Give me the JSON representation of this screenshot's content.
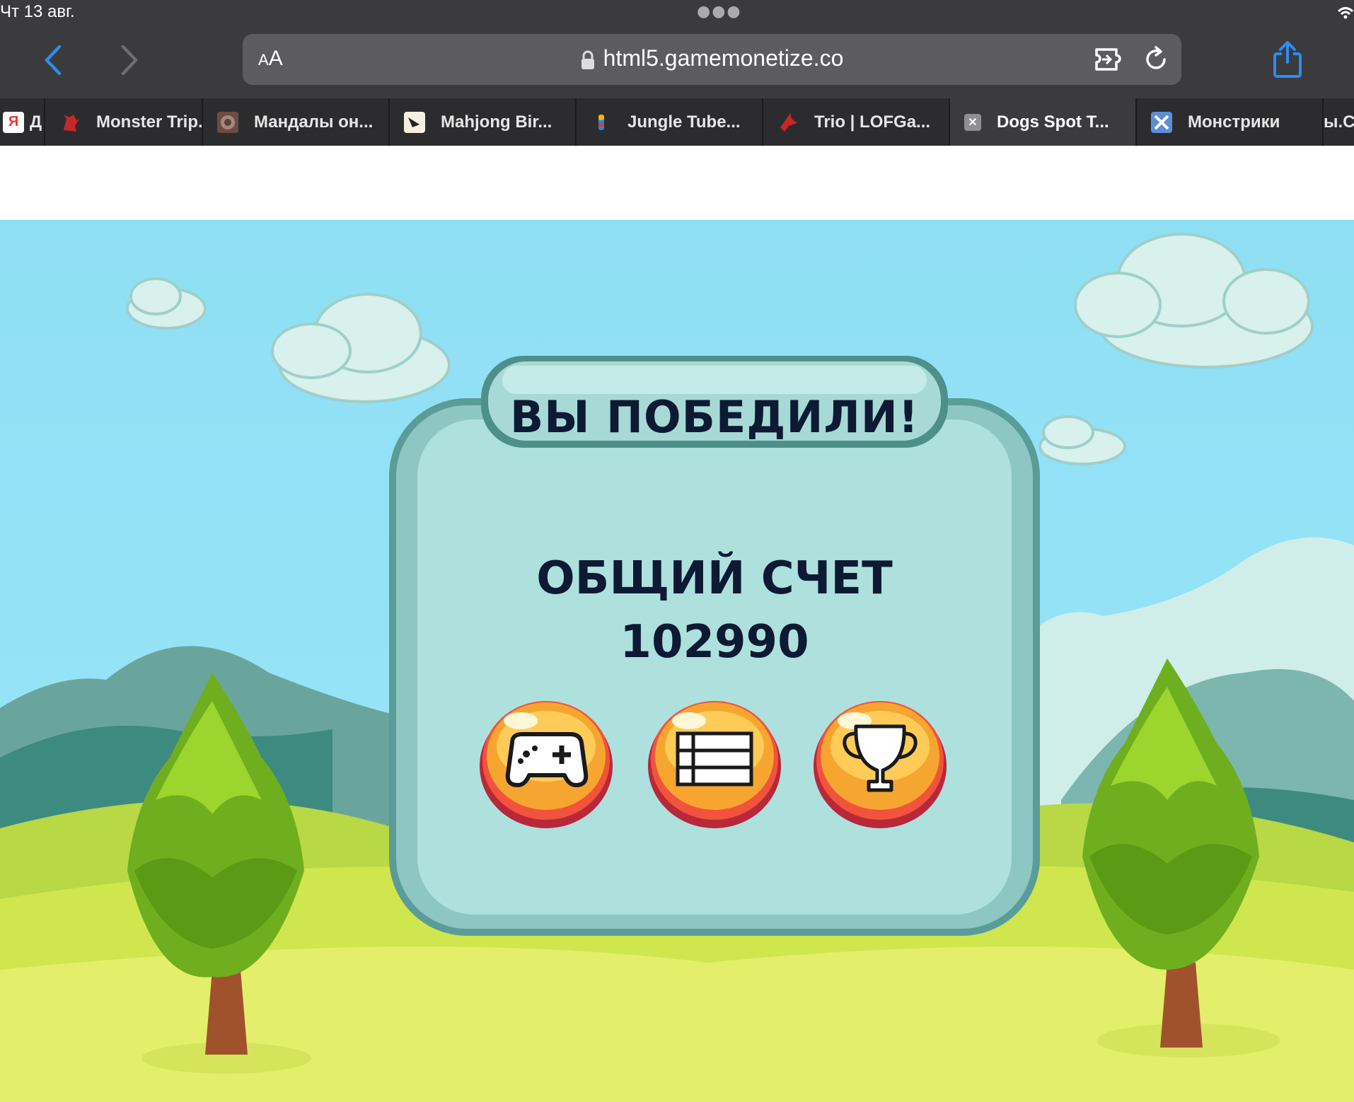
{
  "status_bar": {
    "time": "Чт 13 авг."
  },
  "address_bar": {
    "aa_small": "A",
    "aa_large": "A",
    "url": "html5.gamemonetize.co"
  },
  "tabs": [
    {
      "label": "Д",
      "favicon_text": "Я",
      "favicon_color": "#e53935"
    },
    {
      "label": "Monster Trip...",
      "favicon_color": "#c62828"
    },
    {
      "label": "Мандалы он...",
      "favicon_color": "#6d4c41"
    },
    {
      "label": "Mahjong Bir...",
      "favicon_color": "#f5f0e1"
    },
    {
      "label": "Jungle Tube...",
      "favicon_color": "#ffb300"
    },
    {
      "label": "Trio | LOFGa...",
      "favicon_color": "#c62828"
    },
    {
      "label": "Dogs Spot T...",
      "favicon_text": "✕",
      "favicon_color": "#8e8e93",
      "active": true
    },
    {
      "label": "Монстрики",
      "favicon_color": "#5c8fd6"
    },
    {
      "label": "ы.С",
      "favicon_color": "#3b3b3d"
    }
  ],
  "game": {
    "title": "ВЫ ПОБЕДИЛИ!",
    "score_label": "ОБЩИЙ СЧЕТ",
    "score_value": "102990",
    "buttons": [
      "gamepad-icon",
      "list-icon",
      "trophy-icon"
    ]
  },
  "colors": {
    "accent_blue": "#2f8cf0",
    "panel_teal": "#5a9c97",
    "panel_fill": "#aee0de",
    "button_orange": "#f6a630"
  }
}
